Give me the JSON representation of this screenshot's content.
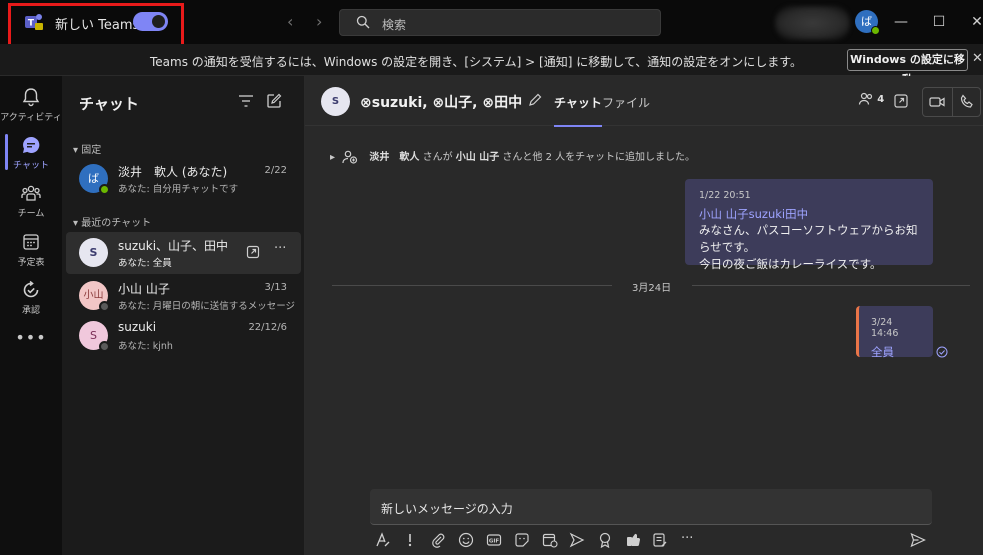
{
  "titlebar": {
    "new_teams_label": "新しい Teams",
    "toggle_on": true,
    "search_placeholder": "検索",
    "avatar_initial": "ば",
    "minimize": "—",
    "maximize": "☐",
    "close": "✕"
  },
  "banner": {
    "message": "Teams の通知を受信するには、Windows の設定を開き、[システム] > [通知] に移動して、通知の設定をオンにします。",
    "button_label": "Windows の設定に移動",
    "close": "✕"
  },
  "appbar": {
    "items": [
      {
        "label": "アクティビティ",
        "icon": "bell-icon"
      },
      {
        "label": "チャット",
        "icon": "chat-icon",
        "active": true
      },
      {
        "label": "チーム",
        "icon": "teams-icon"
      },
      {
        "label": "予定表",
        "icon": "calendar-icon"
      },
      {
        "label": "承認",
        "icon": "approvals-icon"
      }
    ],
    "more": "•••"
  },
  "chatlist": {
    "title": "チャット",
    "pinned_header": "固定",
    "recent_header": "最近のチャット",
    "pinned": [
      {
        "name": "淡井　軟人 (あなた)",
        "preview": "あなた: 自分用チャットです",
        "date": "2/22",
        "avatar": "ば",
        "status": "available"
      }
    ],
    "recent": [
      {
        "name": "suzuki、山子、田中",
        "preview": "あなた: 全員",
        "date": "",
        "avatar": "S",
        "selected": true
      },
      {
        "name": "小山 山子",
        "preview": "あなた: 月曜日の朝に送信するメッセージ",
        "date": "3/13",
        "avatar": "小山",
        "status": "offline"
      },
      {
        "name": "suzuki",
        "preview": "あなた: kjnh",
        "date": "22/12/6",
        "avatar": "S",
        "status": "offline"
      }
    ],
    "item_more": "···"
  },
  "chat": {
    "title": "⊗suzuki, ⊗山子, ⊗田中",
    "group_avatar": "S",
    "tabs": [
      "チャット",
      "ファイル"
    ],
    "participant_count": "4",
    "system_message_name1": "淡井　軟人",
    "system_message_mid": " さんが ",
    "system_message_name2": "小山 山子",
    "system_message_tail": " さんと他 2 人をチャットに追加しました。",
    "messages": [
      {
        "time": "1/22 20:51",
        "mention": "小山 山子suzuki田中",
        "lines": [
          "みなさん、パスコーソフトウェアからお知らせです。",
          "今日の夜ご飯はカレーライスです。"
        ]
      },
      {
        "time": "3/24 14:46",
        "mention": "全員"
      }
    ],
    "date_divider": "3月24日",
    "compose_placeholder": "新しいメッセージの入力"
  },
  "colors": {
    "accent": "#7f85f5",
    "bubble": "#3d3c5a",
    "important_bar": "#e97548",
    "highlight_box": "#e81a1a",
    "available": "#6bb700"
  }
}
